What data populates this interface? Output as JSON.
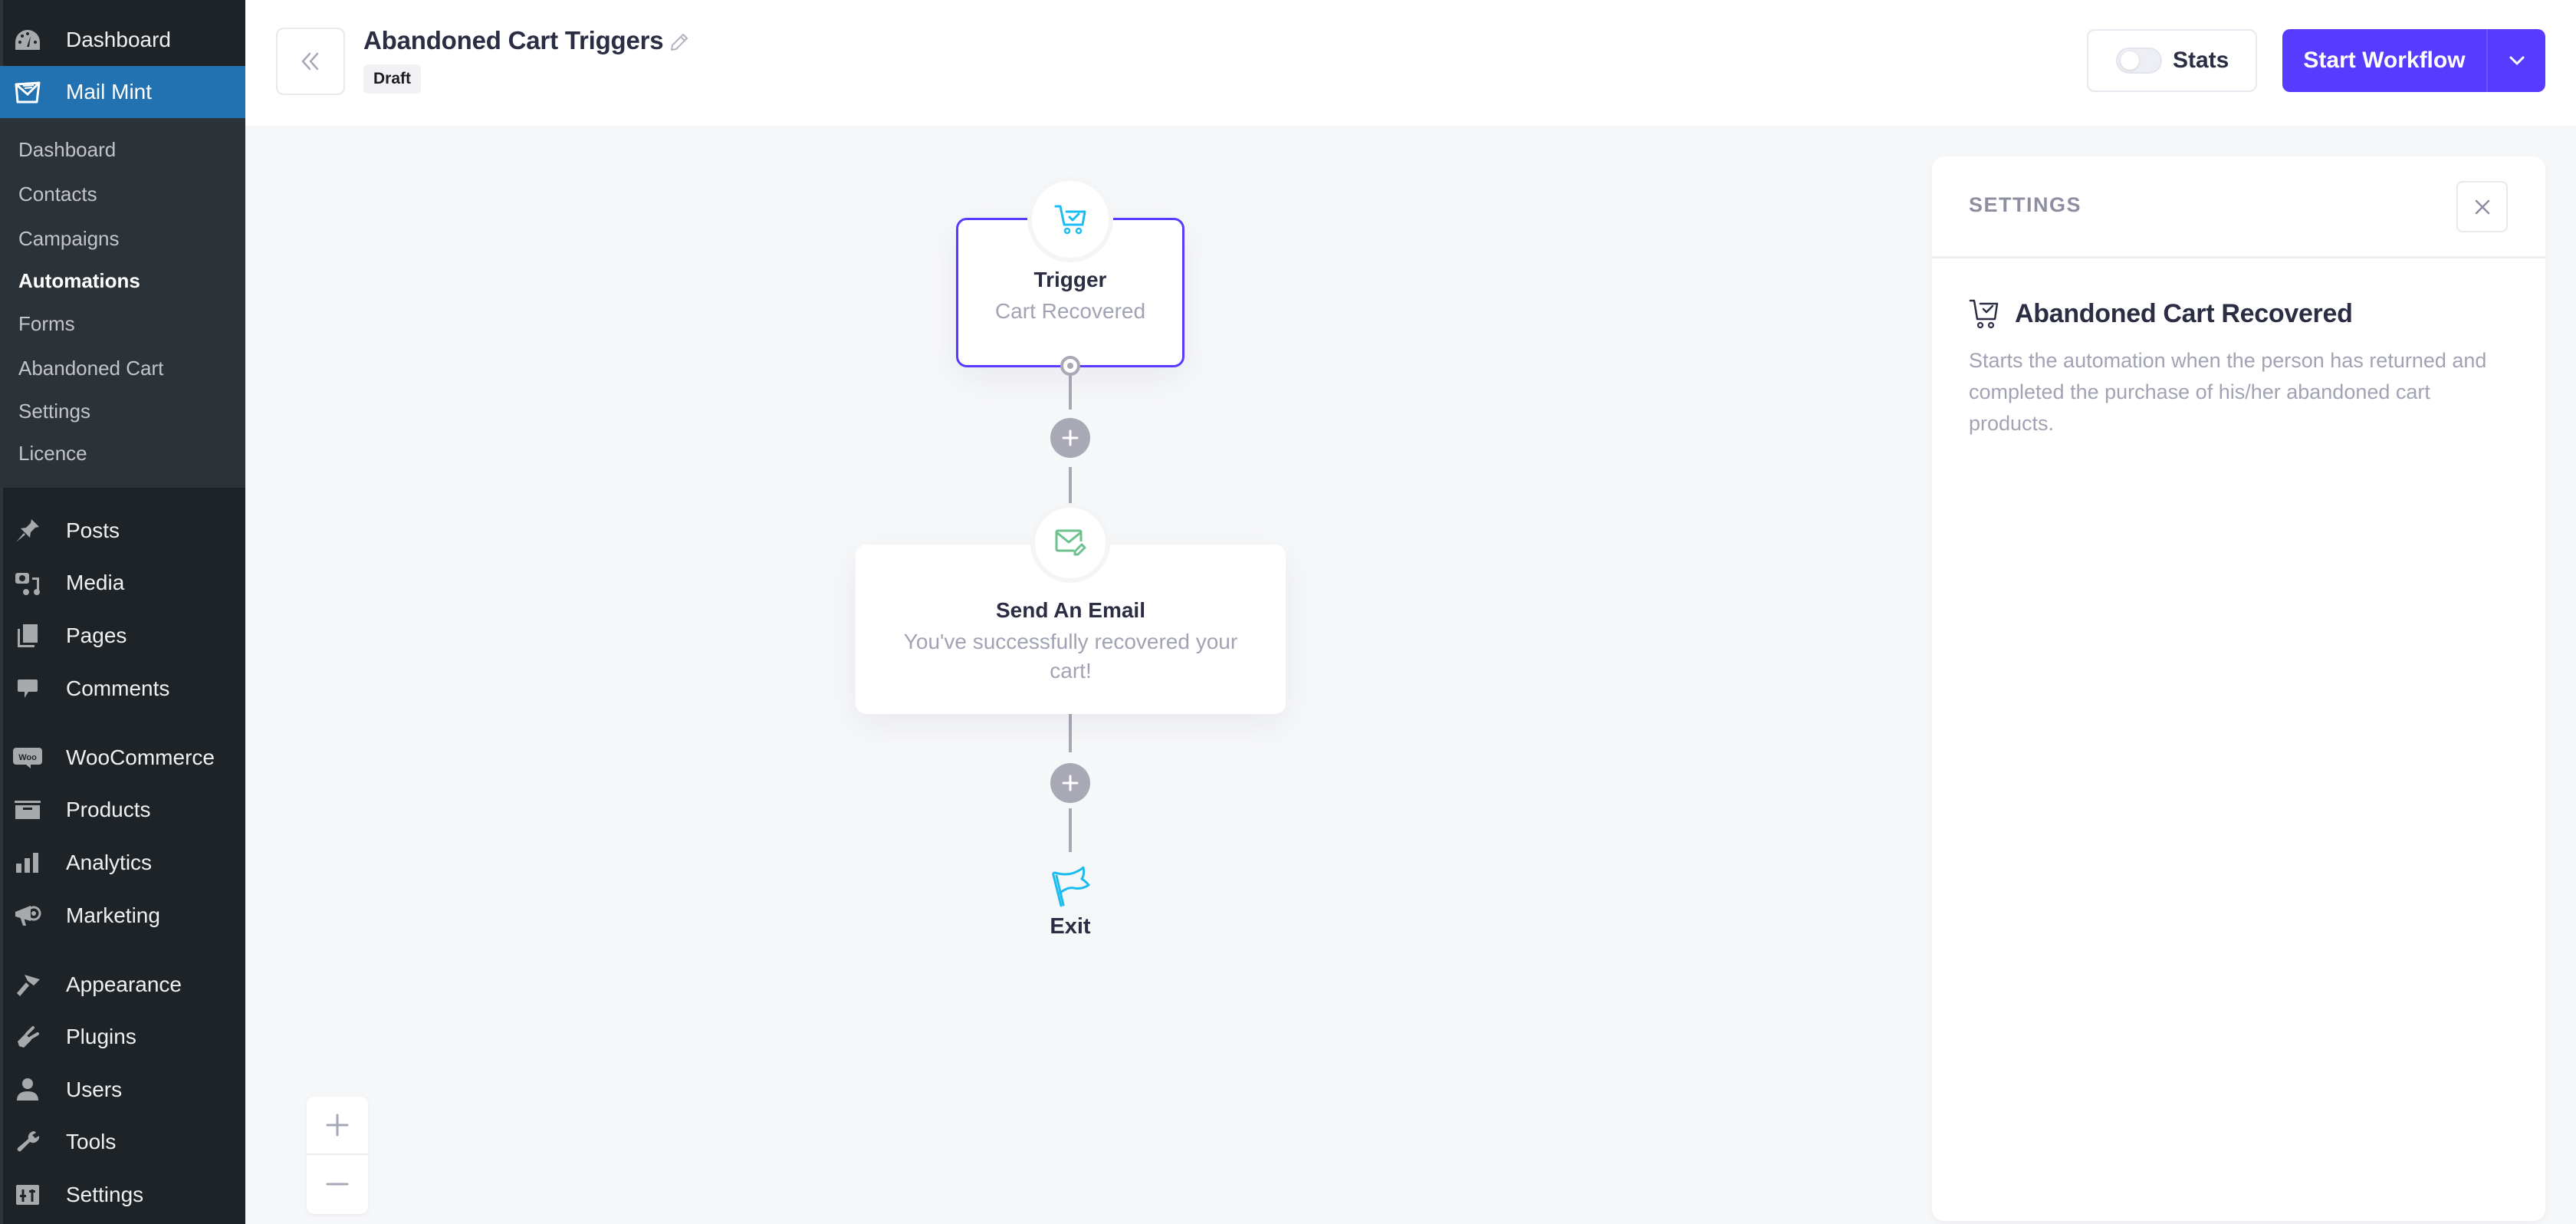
{
  "sidebar": {
    "top_items": [
      {
        "label": "Dashboard",
        "icon": "dashboard-icon"
      },
      {
        "label": "Mail Mint",
        "icon": "mail-mint-icon",
        "active": true
      }
    ],
    "submenu": [
      "Dashboard",
      "Contacts",
      "Campaigns",
      "Automations",
      "Forms",
      "Abandoned Cart",
      "Settings",
      "Licence"
    ],
    "submenu_current": "Automations",
    "items": [
      {
        "label": "Posts",
        "icon": "pin-icon"
      },
      {
        "label": "Media",
        "icon": "media-icon"
      },
      {
        "label": "Pages",
        "icon": "pages-icon"
      },
      {
        "label": "Comments",
        "icon": "comment-icon"
      },
      {
        "label": "WooCommerce",
        "icon": "woo-icon"
      },
      {
        "label": "Products",
        "icon": "archive-icon"
      },
      {
        "label": "Analytics",
        "icon": "bar-chart-icon"
      },
      {
        "label": "Marketing",
        "icon": "megaphone-icon"
      },
      {
        "label": "Appearance",
        "icon": "brush-icon"
      },
      {
        "label": "Plugins",
        "icon": "plug-icon"
      },
      {
        "label": "Users",
        "icon": "user-icon"
      },
      {
        "label": "Tools",
        "icon": "wrench-icon"
      },
      {
        "label": "Settings",
        "icon": "sliders-icon"
      }
    ]
  },
  "header": {
    "title": "Abandoned Cart Triggers",
    "status_badge": "Draft",
    "stats_label": "Stats",
    "stats_enabled": false,
    "start_label": "Start Workflow"
  },
  "colors": {
    "accent": "#573bff",
    "wp_active": "#2271b1",
    "trigger_icon": "#1bbcf0",
    "email_icon": "#6cc18e",
    "connector": "#a9a9b5"
  },
  "workflow": {
    "trigger": {
      "title": "Trigger",
      "desc": "Cart Recovered",
      "icon": "cart-check-icon"
    },
    "action": {
      "title": "Send An Email",
      "desc": "You've successfully recovered your cart!",
      "icon": "email-edit-icon"
    },
    "exit": {
      "label": "Exit",
      "icon": "flag-icon"
    }
  },
  "zoom_controls": {
    "in": "+",
    "out": "−"
  },
  "settings_panel": {
    "heading": "SETTINGS",
    "trigger_title": "Abandoned Cart Recovered",
    "trigger_desc": "Starts the automation when the person has returned and completed the purchase of his/her abandoned cart products."
  }
}
